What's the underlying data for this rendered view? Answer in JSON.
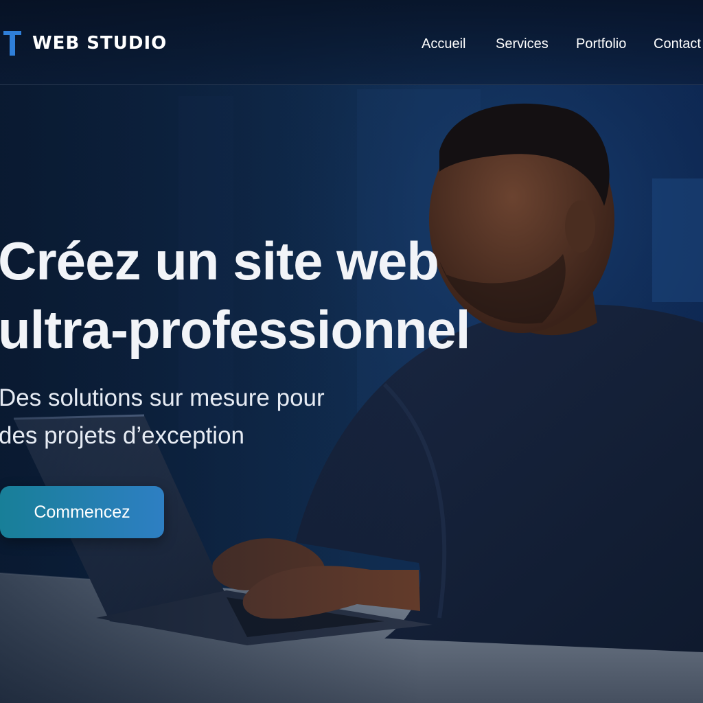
{
  "header": {
    "brand": {
      "logo_icon": "t-logo-icon",
      "name": "WEB STUDIO"
    },
    "nav": [
      {
        "label": "Accueil"
      },
      {
        "label": "Services"
      },
      {
        "label": "Portfolio"
      },
      {
        "label": "Contact"
      }
    ]
  },
  "hero": {
    "title_lines": [
      "Créez un site web",
      "ultra-professionnel"
    ],
    "subtitle_lines": [
      "Des solutions sur mesure pour",
      "des projets d’exception"
    ],
    "cta_label": "Commencez"
  },
  "colors": {
    "accent": "#2f7fd8",
    "cta_start": "#187f98",
    "cta_end": "#2e7fc3",
    "background": "#0c1f3a"
  }
}
